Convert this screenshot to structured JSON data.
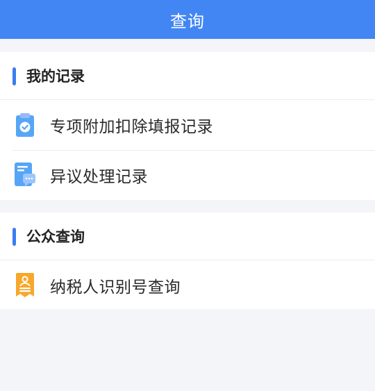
{
  "header": {
    "title": "查询"
  },
  "sections": [
    {
      "title": "我的记录",
      "items": [
        {
          "label": "专项附加扣除填报记录",
          "icon": "clipboard-check-icon"
        },
        {
          "label": "异议处理记录",
          "icon": "document-chat-icon"
        }
      ]
    },
    {
      "title": "公众查询",
      "items": [
        {
          "label": "纳税人识别号查询",
          "icon": "taxpayer-id-badge-icon"
        }
      ]
    }
  ],
  "colors": {
    "header_bg": "#4286f4",
    "accent": "#3b7cf0",
    "page_bg": "#f4f5f9",
    "icon_blue": "#4a9df5",
    "icon_orange": "#f7a72a"
  }
}
